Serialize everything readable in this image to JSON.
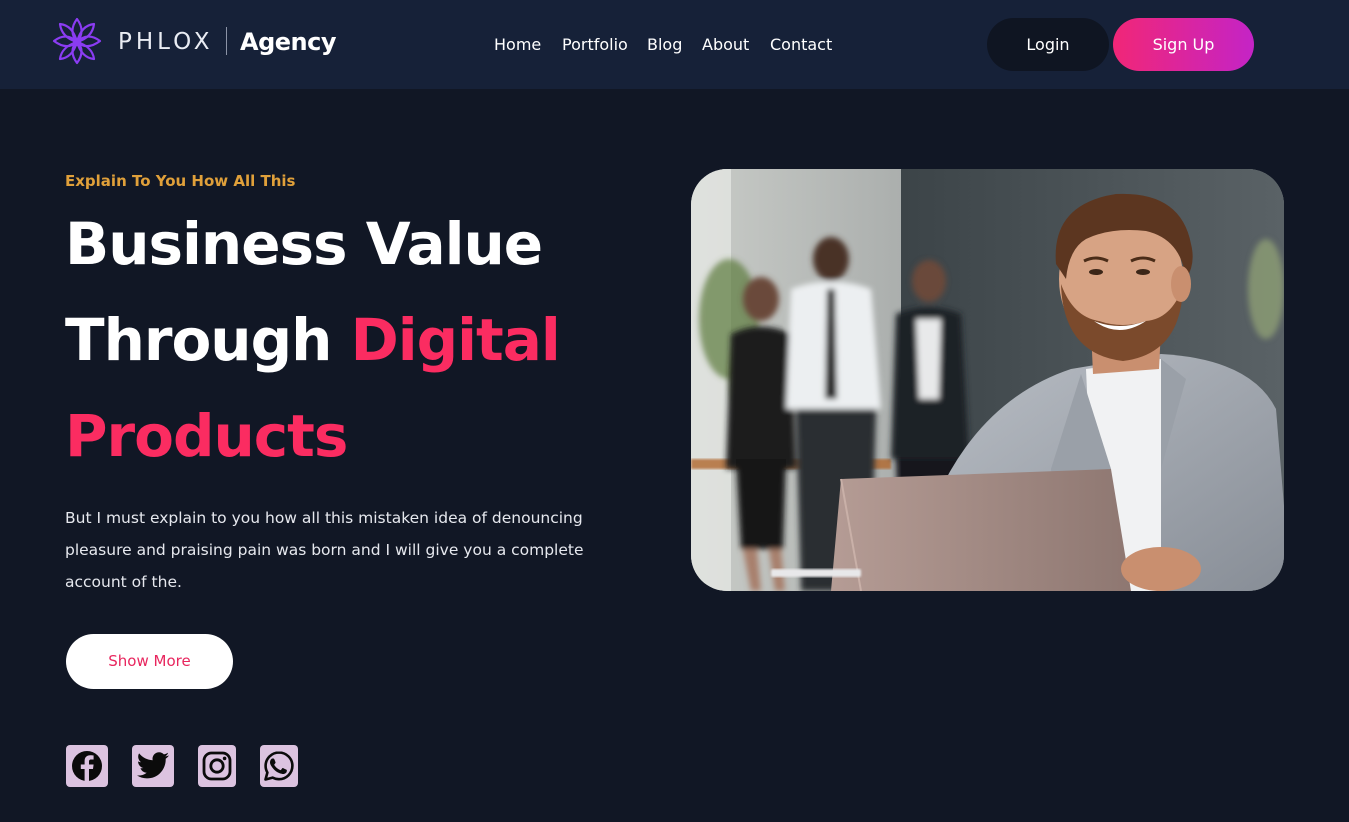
{
  "brand": {
    "name": "PHLOX",
    "sub": "Agency",
    "logo_icon": "lotus-flower-icon",
    "accent_color": "#8b3cf3"
  },
  "nav": {
    "items": [
      {
        "label": "Home"
      },
      {
        "label": "Portfolio"
      },
      {
        "label": "Blog"
      },
      {
        "label": "About"
      },
      {
        "label": "Contact"
      }
    ],
    "login_label": "Login",
    "signup_label": "Sign Up"
  },
  "hero": {
    "eyebrow": "Explain To You How All This",
    "headline_part1": "Business Value Through ",
    "headline_accent": "Digital Products",
    "paragraph": "But I must explain to you how all this mistaken idea of denouncing pleasure and praising pain was born and I will give you a complete account of the.",
    "button_label": "Show More",
    "image_icon": "businessman-photo"
  },
  "socials": [
    {
      "icon": "facebook-icon"
    },
    {
      "icon": "twitter-icon"
    },
    {
      "icon": "instagram-icon"
    },
    {
      "icon": "whatsapp-icon"
    }
  ],
  "colors": {
    "background": "#111725",
    "navbar": "#162138",
    "accent_pink": "#fb2c61",
    "eyebrow_gold": "#e0a03a",
    "signup_gradient_start": "#f12677",
    "signup_gradient_end": "#c424c6",
    "social_tile": "#dcc3e0"
  }
}
